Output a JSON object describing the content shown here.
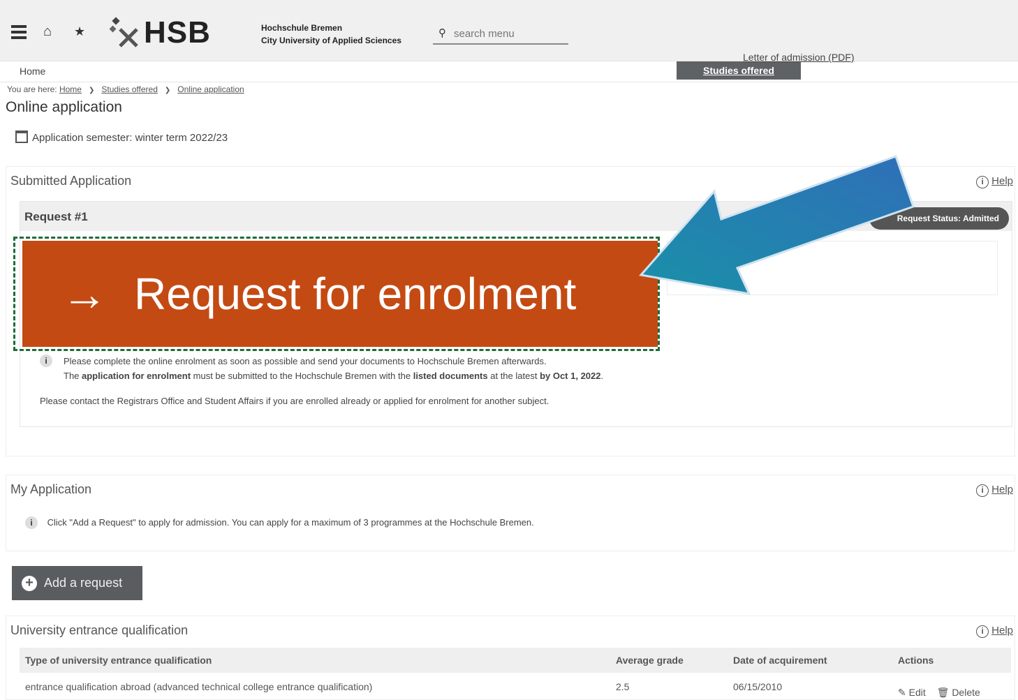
{
  "header": {
    "logo_text": "HSB",
    "university_line1": "Hochschule Bremen",
    "university_line2": "City University of Applied Sciences",
    "search_placeholder": "search menu"
  },
  "nav": {
    "home": "Home",
    "active_tab": "Studies offered"
  },
  "breadcrumb": {
    "prefix": "You are here:",
    "items": [
      "Home",
      "Studies offered",
      "Online application"
    ]
  },
  "page": {
    "title": "Online application",
    "semester": "Application semester: winter term 2022/23"
  },
  "submitted": {
    "heading": "Submitted Application",
    "help": "Help",
    "request_title": "Request #1",
    "status": "Request Status: Admitted",
    "letter_link": "Letter of admission (PDF)",
    "enrol_button": "Request for enrolment",
    "info_line1": "Please complete the online enrolment as soon as possible and send your documents to Hochschule Bremen afterwards.",
    "info_line2_a": "The ",
    "info_line2_b": "application for enrolment",
    "info_line2_c": " must be submitted to the Hochschule Bremen with the ",
    "info_line2_d": "listed documents",
    "info_line2_e": " at the latest ",
    "info_line2_f": "by Oct 1, 2022",
    "info_line2_g": ".",
    "contact": "Please contact the Registrars Office and Student Affairs if you are enrolled already or applied for enrolment for another subject."
  },
  "my_application": {
    "heading": "My Application",
    "help": "Help",
    "info": "Click \"Add a Request\" to apply for admission. You can apply for a maximum of 3 programmes at the Hochschule Bremen.",
    "add_button": "Add a request"
  },
  "qualification": {
    "heading": "University entrance qualification",
    "help": "Help",
    "columns": [
      "Type of university entrance qualification",
      "Average grade",
      "Date of acquirement",
      "Actions"
    ],
    "rows": [
      {
        "type": "entrance qualification abroad (advanced technical college entrance qualification)",
        "grade": "2.5",
        "date": "06/15/2010",
        "edit": "Edit",
        "delete": "Delete"
      }
    ]
  },
  "colors": {
    "enrol_button": "#c44a13",
    "annotation_arrow": "#2a7ab8",
    "highlight_border": "#1e6b3a"
  }
}
